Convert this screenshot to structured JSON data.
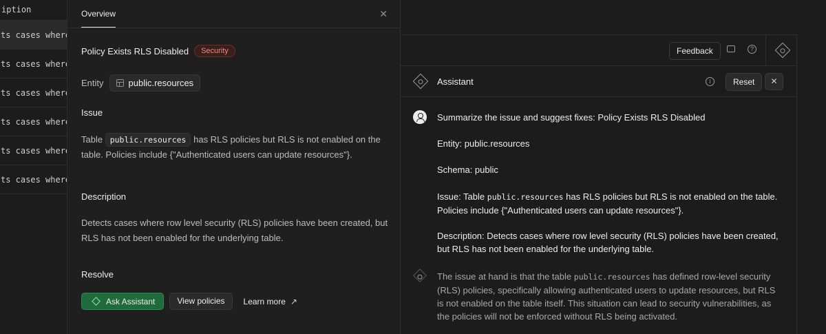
{
  "background_table": {
    "header": "iption",
    "rows": [
      "ts cases where",
      "ts cases where",
      "ts cases where",
      "ts cases where",
      "ts cases where",
      "ts cases where"
    ]
  },
  "overview": {
    "tab_label": "Overview",
    "title": "Policy Exists RLS Disabled",
    "badge": "Security",
    "entity_label": "Entity",
    "entity_value": "public.resources",
    "issue_heading": "Issue",
    "issue_pre": "Table",
    "issue_code": "public.resources",
    "issue_post": "has RLS policies but RLS is not enabled on the table. Policies include {\"Authenticated users can update resources\"}.",
    "description_heading": "Description",
    "description_text": "Detects cases where row level security (RLS) policies have been created, but RLS has not been enabled for the underlying table.",
    "resolve_heading": "Resolve",
    "ask_assistant": "Ask Assistant",
    "view_policies": "View policies",
    "learn_more": "Learn more"
  },
  "topbar": {
    "feedback": "Feedback"
  },
  "assistant": {
    "title": "Assistant",
    "reset": "Reset",
    "user_message": {
      "line1": "Summarize the issue and suggest fixes: Policy Exists RLS Disabled",
      "line2": "Entity: public.resources",
      "line3": "Schema: public",
      "issue_pre": "Issue: Table",
      "issue_code": "public.resources",
      "issue_post": "has RLS policies but RLS is not enabled on the table. Policies include {\"Authenticated users can update resources\"}.",
      "description": "Description: Detects cases where row level security (RLS) policies have been created, but RLS has not been enabled for the underlying table."
    },
    "ai_message": {
      "pre": "The issue at hand is that the table",
      "code": "public.resources",
      "post": "has defined row-level security (RLS) policies, specifically allowing authenticated users to update resources, but RLS is not enabled on the table itself. This situation can lead to security vulnerabilities, as the policies will not be enforced without RLS being activated."
    }
  },
  "colors": {
    "background": "#1c1c1c",
    "panel": "#1f1f1f",
    "accent_green": "#1f6b3c",
    "security_badge": "#f08a7a"
  }
}
